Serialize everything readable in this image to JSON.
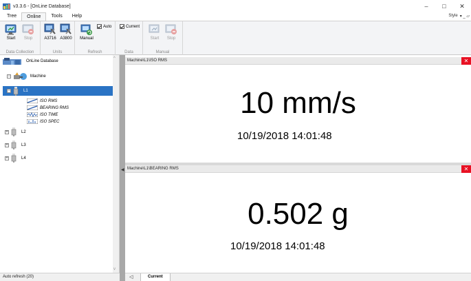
{
  "window": {
    "title": "v3.3.6 - [OnLine Database]",
    "controls": {
      "minimize": "–",
      "maximize": "□",
      "close": "✕"
    }
  },
  "ribbon_tabs": [
    "Tree",
    "Online",
    "Tools",
    "Help"
  ],
  "active_tab": "Online",
  "style_menu": {
    "label": "Style",
    "extra": "▾  _  ▱"
  },
  "ribbon": {
    "groups": {
      "data_collection": {
        "label": "Data Collection",
        "buttons": [
          {
            "label": "Start",
            "icon": "start-collection-icon",
            "enabled": true
          },
          {
            "label": "Stop",
            "icon": "stop-collection-icon",
            "enabled": false
          }
        ]
      },
      "units": {
        "label": "Units",
        "buttons": [
          {
            "label": "A3716",
            "icon": "a3716-tools-icon",
            "enabled": true
          },
          {
            "label": "A3800",
            "icon": "a3800-tools-icon",
            "enabled": true
          }
        ]
      },
      "refresh": {
        "label": "Refresh",
        "buttons": [
          {
            "label": "Manual",
            "icon": "manual-refresh-icon",
            "enabled": true
          }
        ],
        "auto_checkbox": {
          "label": "Auto",
          "checked": true
        }
      },
      "data": {
        "label": "Data",
        "current_checkbox": {
          "label": "Current",
          "checked": true
        }
      },
      "manual": {
        "label": "Manual",
        "buttons": [
          {
            "label": "Start",
            "icon": "manual-start-icon",
            "enabled": false
          },
          {
            "label": "Stop",
            "icon": "manual-stop-icon",
            "enabled": false
          }
        ]
      }
    }
  },
  "tree": {
    "root": "OnLine Database",
    "machine": "Machine",
    "nodes": [
      "L1",
      "L2",
      "L3",
      "L4"
    ],
    "selected": "L1",
    "l1_children": [
      "ISO RMS",
      "BEARING RMS",
      "ISO TIME",
      "ISO SPEC"
    ]
  },
  "panes": [
    {
      "path": "Machine\\L1\\ISO RMS",
      "value": "10 mm/s",
      "timestamp": "10/19/2018 14:01:48"
    },
    {
      "path": "Machine\\L1\\BEARING RMS",
      "value": "0.502 g",
      "timestamp": "10/19/2018 14:01:48"
    }
  ],
  "status": {
    "text": "Auto refresh (20)"
  },
  "doc_tabs": {
    "arrow": "◁",
    "current": "Current"
  },
  "colors": {
    "selection": "#2a73c4",
    "close_red": "#e81123"
  }
}
